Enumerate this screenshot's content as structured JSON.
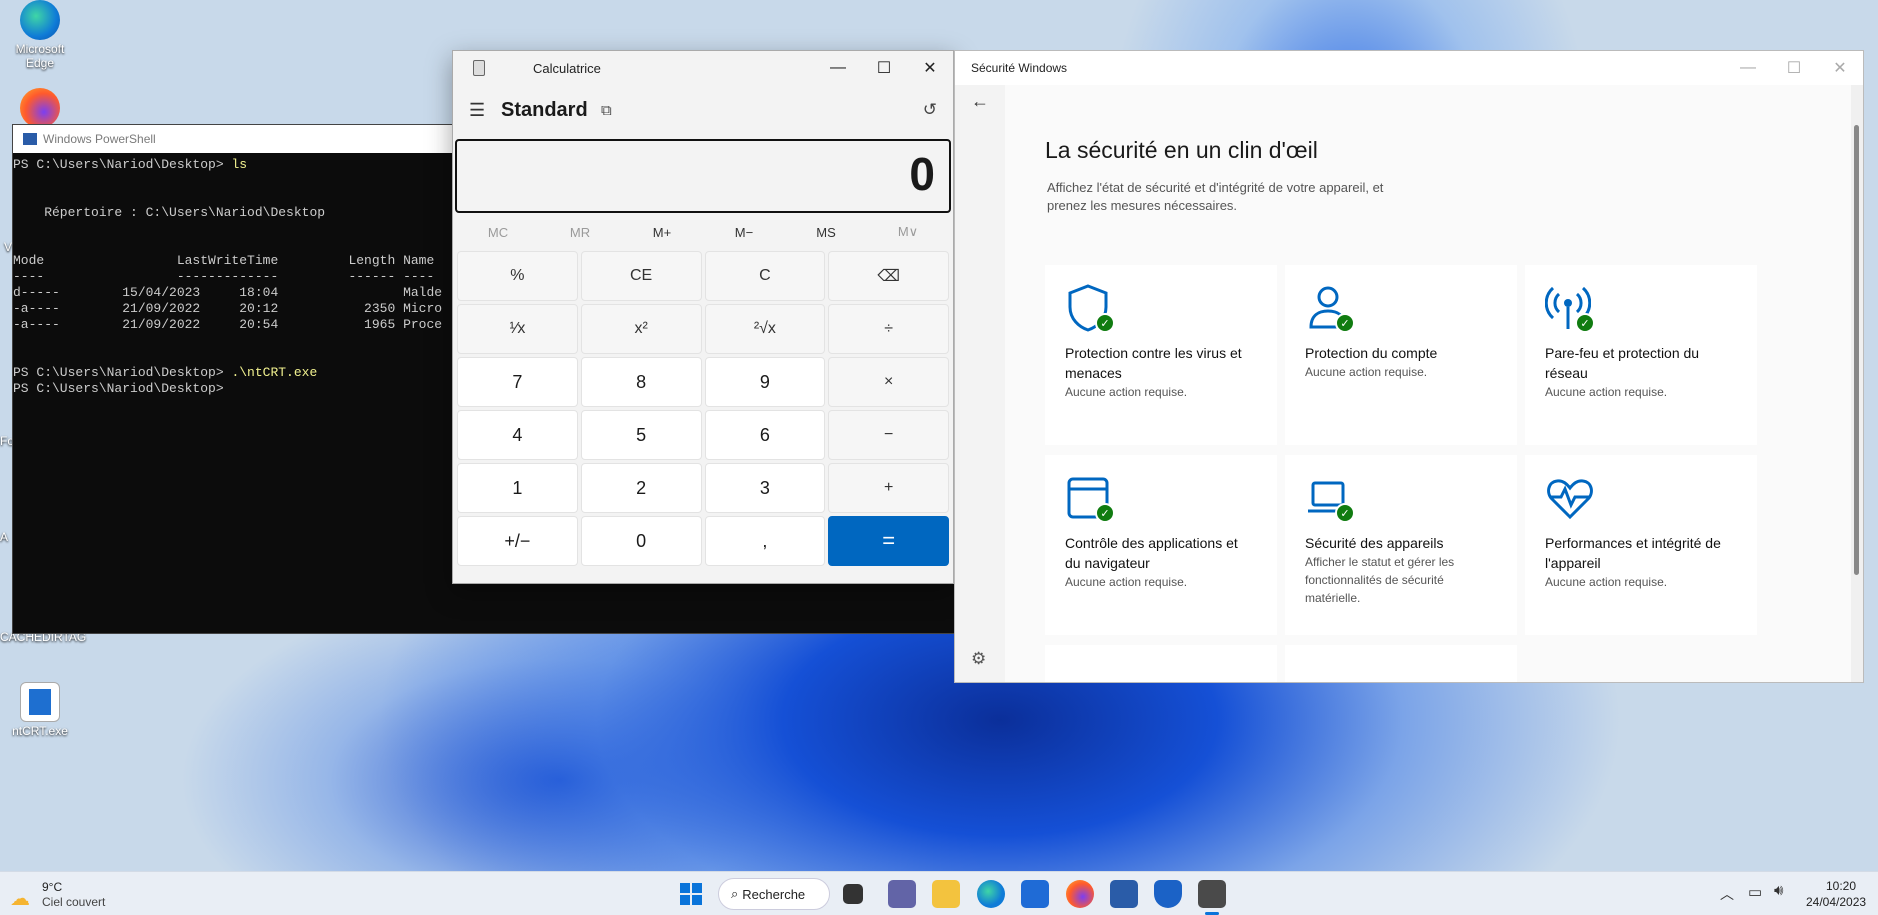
{
  "desktop": {
    "icons": [
      {
        "label": "Microsoft Edge"
      },
      {
        "label": "ntCRT.exe"
      }
    ],
    "partial_labels": [
      "Fo",
      "A",
      "V",
      "CACHEDIRTAG"
    ]
  },
  "powershell": {
    "title": "Windows PowerShell",
    "lines": [
      {
        "text": "PS C:\\Users\\Nariod\\Desktop> ls",
        "cmd": true
      },
      {
        "text": ""
      },
      {
        "text": ""
      },
      {
        "text": "    Répertoire : C:\\Users\\Nariod\\Desktop"
      },
      {
        "text": ""
      },
      {
        "text": ""
      },
      {
        "text": "Mode                 LastWriteTime         Length Name"
      },
      {
        "text": "----                 -------------         ------ ----"
      },
      {
        "text": "d-----        15/04/2023     18:04                Malde"
      },
      {
        "text": "-a----        21/09/2022     20:12           2350 Micro"
      },
      {
        "text": "-a----        21/09/2022     20:54           1965 Proce"
      },
      {
        "text": ""
      },
      {
        "text": ""
      },
      {
        "text": "PS C:\\Users\\Nariod\\Desktop> .\\ntCRT.exe",
        "cmd": true
      },
      {
        "text": "PS C:\\Users\\Nariod\\Desktop>"
      }
    ]
  },
  "calculator": {
    "title": "Calculatrice",
    "mode": "Standard",
    "display": "0",
    "memory": [
      "MC",
      "MR",
      "M+",
      "M−",
      "MS",
      "M∨"
    ],
    "keys": [
      "%",
      "CE",
      "C",
      "⌫",
      "¹⁄x",
      "x²",
      "²√x",
      "÷",
      "7",
      "8",
      "9",
      "×",
      "4",
      "5",
      "6",
      "−",
      "1",
      "2",
      "3",
      "+",
      "+/−",
      "0",
      ",",
      "="
    ]
  },
  "security": {
    "title": "Sécurité Windows",
    "heading": "La sécurité en un clin d'œil",
    "subtitle": "Affichez l'état de sécurité et d'intégrité de votre appareil, et prenez les mesures nécessaires.",
    "tiles": [
      {
        "title": "Protection contre les virus et menaces",
        "status": "Aucune action requise.",
        "icon": "shield-icon"
      },
      {
        "title": "Protection du compte",
        "status": "Aucune action requise.",
        "icon": "account-icon"
      },
      {
        "title": "Pare-feu et protection du réseau",
        "status": "Aucune action requise.",
        "icon": "antenna-icon"
      },
      {
        "title": "Contrôle des applications et du navigateur",
        "status": "Aucune action requise.",
        "icon": "browser-icon"
      },
      {
        "title": "Sécurité des appareils",
        "status": "Afficher le statut et gérer les fonctionnalités de sécurité matérielle.",
        "icon": "laptop-icon"
      },
      {
        "title": "Performances et intégrité de l'appareil",
        "status": "Aucune action requise.",
        "icon": "heart-icon"
      }
    ]
  },
  "taskbar": {
    "weather_temp": "9°C",
    "weather_desc": "Ciel couvert",
    "search_label": "Recherche",
    "time": "10:20",
    "date": "24/04/2023"
  }
}
